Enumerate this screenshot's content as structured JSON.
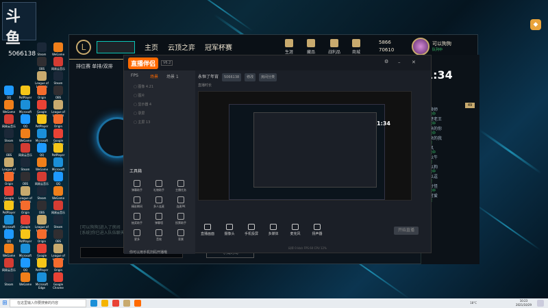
{
  "desktop": {
    "logo_text": "斗鱼",
    "room_label": "5066138",
    "icons": [
      {
        "label": "Google Chrome",
        "color": "#e94235"
      },
      {
        "label": "PotPlayer",
        "color": "#f5c518"
      },
      {
        "label": "Microsoft Edge",
        "color": "#1b8fd8"
      },
      {
        "label": "QQ",
        "color": "#1e9aff"
      },
      {
        "label": "WeGame",
        "color": "#f07f1a"
      },
      {
        "label": "网易云音乐",
        "color": "#d43c33"
      },
      {
        "label": "Steam",
        "color": "#1b2838"
      },
      {
        "label": "OBS",
        "color": "#302e31"
      },
      {
        "label": "League of Legends",
        "color": "#c8aa6e"
      },
      {
        "label": "Origin",
        "color": "#f56c2d"
      }
    ]
  },
  "lol": {
    "nav": [
      "主页",
      "云顶之弈",
      "冠军杯赛"
    ],
    "resources": [
      "生涯",
      "藏品",
      "战利品",
      "商城"
    ],
    "currency": [
      "5866",
      "70610"
    ],
    "player": "可以狗狗",
    "player_status": "队列中",
    "mode": "排位赛 单排/双排",
    "chat_lines": [
      "[可以狗狗]进入了房间",
      "[系统]你已进入队伍聊天"
    ],
    "search_btn": "寻找对局"
  },
  "friends": {
    "time": "1:34",
    "count": "49",
    "list": [
      {
        "name": "召唤师",
        "status": "游戏中"
      },
      {
        "name": "隔壁老王",
        "status": "游戏中"
      },
      {
        "name": "未来的你",
        "status": "游戏中"
      },
      {
        "name": "未来的我",
        "status": "在线"
      },
      {
        "name": "听风",
        "status": "游戏中"
      },
      {
        "name": "可以牛",
        "status": "在线"
      },
      {
        "name": "可以狗",
        "status": "游戏中"
      },
      {
        "name": "可以逗",
        "status": "在线"
      },
      {
        "name": "飘分怪",
        "status": "游戏中"
      },
      {
        "name": "小可爱",
        "status": "在线"
      }
    ]
  },
  "stream_app": {
    "logo": "直播伴侣",
    "version": "V6.2",
    "tabs": [
      "FPS",
      "场景",
      "场景 1"
    ],
    "scenes": [
      "图像 4.21",
      "图片",
      "显示器 4",
      "录屏",
      "主屏 13"
    ],
    "tools_title": "工具箱",
    "tools": [
      "弹幕助手",
      "礼物助手",
      "主播任务",
      "精彩瞬间",
      "多人连麦",
      "连麦PK",
      "抽奖助手",
      "弹幕墙",
      "投票助手",
      "更多",
      "音效",
      "背景"
    ],
    "room_title": "永恒了年宵",
    "room_id": "5066138",
    "chips": [
      "修改",
      "房间分类"
    ],
    "live_time": "直播时长",
    "bottom": [
      "直播画面",
      "摄像头",
      "手机投屏",
      "多媒体",
      "麦克风",
      "扬声器"
    ],
    "start_btn": "开始直播",
    "tip": "你可以用手机扫码开播哦",
    "stats": "码率 0 kb/s  FPS 60  CPU 12%"
  },
  "taskbar": {
    "search_placeholder": "在这里输入你要搜索的内容",
    "temp": "18°C",
    "time": "10:23",
    "date": "2021/10/29"
  }
}
